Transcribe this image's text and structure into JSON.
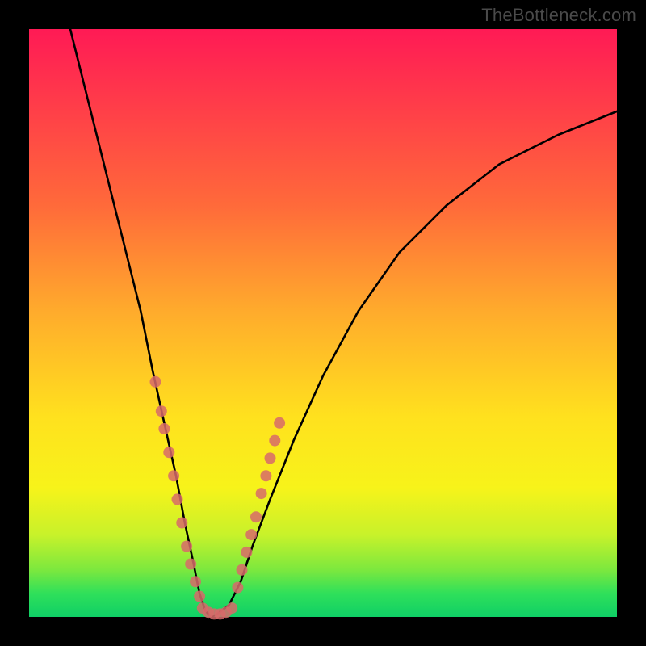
{
  "watermark": "TheBottleneck.com",
  "chart_data": {
    "type": "line",
    "title": "",
    "xlabel": "",
    "ylabel": "",
    "xlim": [
      0,
      100
    ],
    "ylim": [
      0,
      100
    ],
    "gradient_stops": [
      {
        "pos": 0.0,
        "color": "#ff1a55"
      },
      {
        "pos": 0.12,
        "color": "#ff3a4a"
      },
      {
        "pos": 0.3,
        "color": "#ff6a3a"
      },
      {
        "pos": 0.48,
        "color": "#ffab2c"
      },
      {
        "pos": 0.66,
        "color": "#ffe11e"
      },
      {
        "pos": 0.78,
        "color": "#f7f31a"
      },
      {
        "pos": 0.86,
        "color": "#c8f22a"
      },
      {
        "pos": 0.92,
        "color": "#7ce83e"
      },
      {
        "pos": 0.96,
        "color": "#2fe05a"
      },
      {
        "pos": 1.0,
        "color": "#0fcf66"
      }
    ],
    "series": [
      {
        "name": "curve",
        "stroke": "#000000",
        "x": [
          7,
          10,
          13,
          16,
          19,
          21,
          23,
          25,
          26.5,
          28,
          29,
          30,
          31,
          32,
          34,
          36,
          38,
          41,
          45,
          50,
          56,
          63,
          71,
          80,
          90,
          100
        ],
        "y": [
          100,
          88,
          76,
          64,
          52,
          42,
          33,
          24,
          16,
          9,
          4,
          1,
          0,
          0.5,
          2,
          6,
          12,
          20,
          30,
          41,
          52,
          62,
          70,
          77,
          82,
          86
        ]
      }
    ],
    "scatter": [
      {
        "name": "dots-left",
        "color": "#d76a6a",
        "points": [
          {
            "x": 21.5,
            "y": 40
          },
          {
            "x": 22.5,
            "y": 35
          },
          {
            "x": 23.0,
            "y": 32
          },
          {
            "x": 23.8,
            "y": 28
          },
          {
            "x": 24.6,
            "y": 24
          },
          {
            "x": 25.2,
            "y": 20
          },
          {
            "x": 26.0,
            "y": 16
          },
          {
            "x": 26.8,
            "y": 12
          },
          {
            "x": 27.5,
            "y": 9
          },
          {
            "x": 28.3,
            "y": 6
          },
          {
            "x": 29.0,
            "y": 3.5
          }
        ]
      },
      {
        "name": "dots-bottom",
        "color": "#d76a6a",
        "points": [
          {
            "x": 29.5,
            "y": 1.5
          },
          {
            "x": 30.5,
            "y": 0.8
          },
          {
            "x": 31.5,
            "y": 0.5
          },
          {
            "x": 32.5,
            "y": 0.5
          },
          {
            "x": 33.5,
            "y": 0.8
          },
          {
            "x": 34.5,
            "y": 1.5
          }
        ]
      },
      {
        "name": "dots-right",
        "color": "#d76a6a",
        "points": [
          {
            "x": 35.5,
            "y": 5
          },
          {
            "x": 36.2,
            "y": 8
          },
          {
            "x": 37.0,
            "y": 11
          },
          {
            "x": 37.8,
            "y": 14
          },
          {
            "x": 38.6,
            "y": 17
          },
          {
            "x": 39.5,
            "y": 21
          },
          {
            "x": 40.3,
            "y": 24
          },
          {
            "x": 41.0,
            "y": 27
          },
          {
            "x": 41.8,
            "y": 30
          },
          {
            "x": 42.6,
            "y": 33
          }
        ]
      }
    ]
  }
}
